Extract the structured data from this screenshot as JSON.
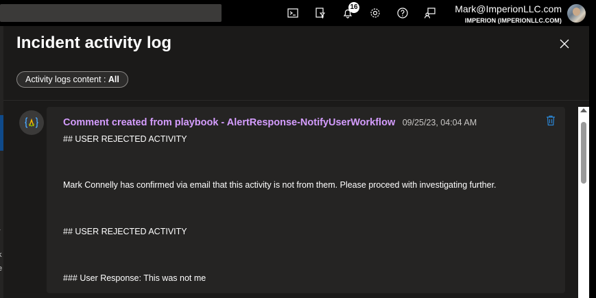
{
  "topbar": {
    "icons": [
      "cloud-shell-icon",
      "directory-filter-icon",
      "notifications-icon",
      "settings-icon",
      "help-icon",
      "feedback-icon"
    ],
    "notification_count": "16",
    "account_email": "Mark@ImperionLLC.com",
    "account_org": "IMPERION (IMPERIONLLC.COM)"
  },
  "panel": {
    "title": "Incident activity log",
    "filter_label": "Activity logs content : ",
    "filter_value": "All"
  },
  "entry": {
    "title": "Comment created from playbook - AlertResponse-NotifyUserWorkflow",
    "timestamp": "09/25/23, 04:04 AM",
    "lines": [
      "## USER REJECTED ACTIVITY",
      "Mark Connelly has confirmed via email that this activity is not from them. Please proceed with investigating further.",
      "## USER REJECTED ACTIVITY",
      "### User Response: This was not me"
    ]
  },
  "background": {
    "left_chars": [
      "r",
      "k",
      "e"
    ]
  },
  "colors": {
    "accent_purple": "#d59dff",
    "link_blue": "#2b88d8",
    "panel_bg": "#1b1a19",
    "card_bg": "#252423"
  }
}
